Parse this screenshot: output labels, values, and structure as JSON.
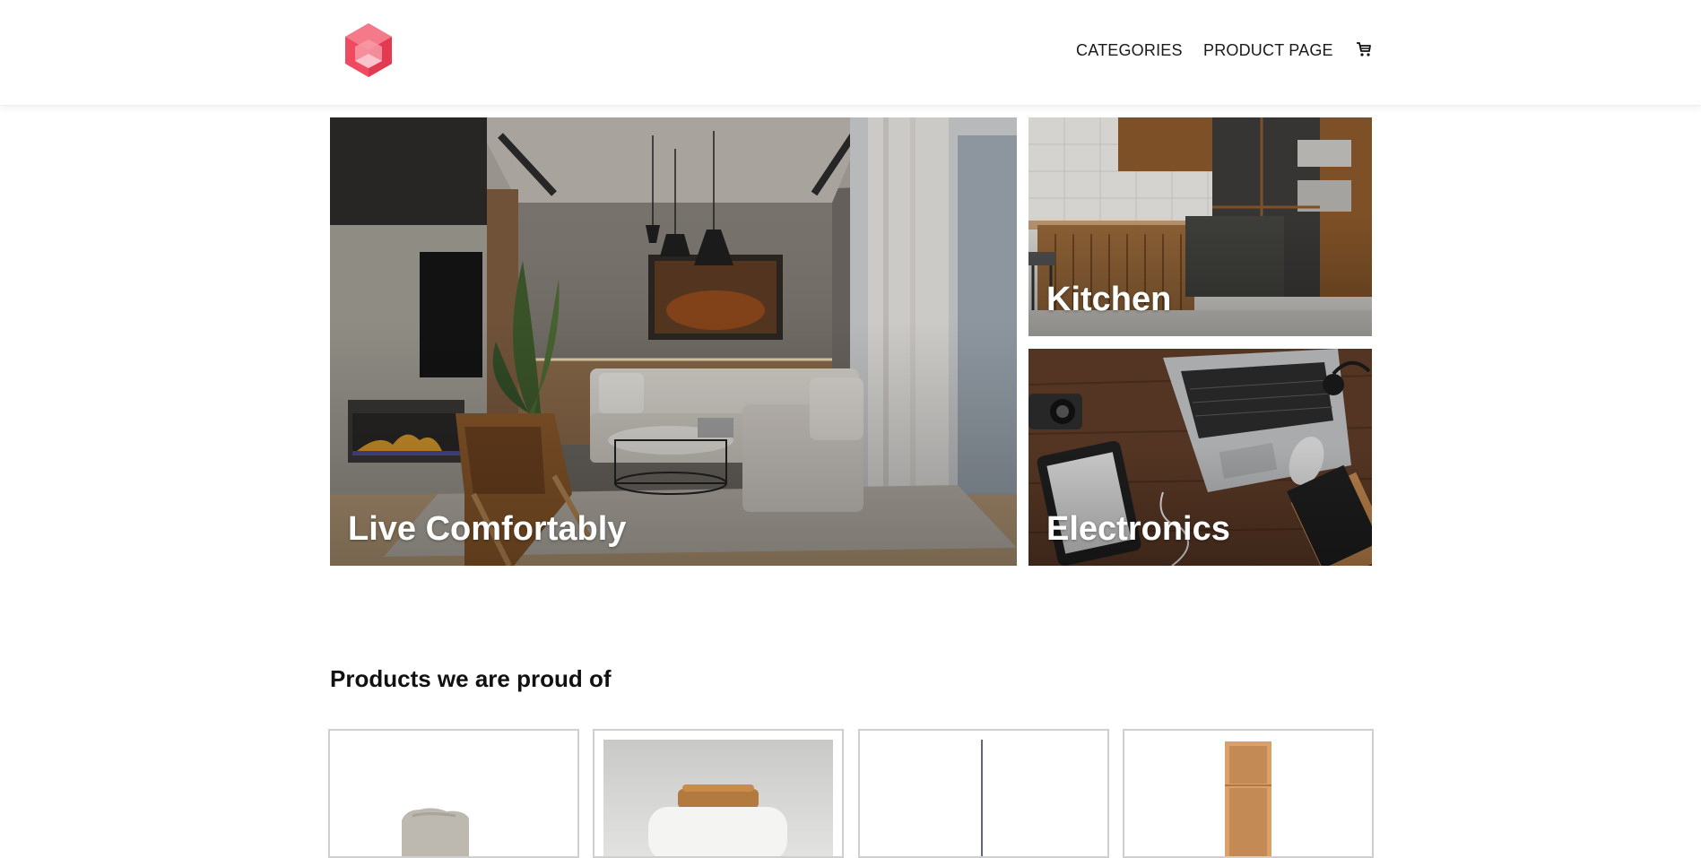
{
  "header": {
    "logo_name": "hexagon-logo",
    "nav": [
      {
        "label": "CATEGORIES"
      },
      {
        "label": "PRODUCT PAGE"
      }
    ],
    "cart_icon": "cart-icon",
    "brand_color": "#ef4a5f"
  },
  "hero": {
    "main": {
      "title": "Live Comfortably"
    },
    "kitchen": {
      "title": "Kitchen"
    },
    "electronics": {
      "title": "Electronics"
    }
  },
  "products": {
    "heading": "Products we are proud of",
    "items": [
      {
        "image": "armchair-image"
      },
      {
        "image": "toaster-image"
      },
      {
        "image": "floor-lamp-image"
      },
      {
        "image": "wooden-shelf-image"
      }
    ]
  }
}
